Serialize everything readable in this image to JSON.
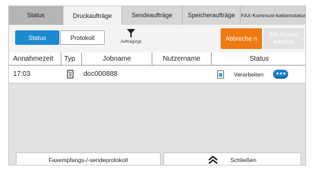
{
  "tabs": [
    {
      "label": "Status"
    },
    {
      "label": "Druckaufträge"
    },
    {
      "label": "Sendeaufträge"
    },
    {
      "label": "Speicheraufträge"
    },
    {
      "label": "FAX-Kommuni-kationsstatus"
    }
  ],
  "toolbar": {
    "status_label": "Status",
    "protokoll_label": "Protokoll",
    "filter_label": "Auftragstyp",
    "cancel_label": "Abbreche n",
    "hold_label": "Alle Drucke anhalten"
  },
  "table": {
    "columns": [
      "Annahmezeit",
      "Typ",
      "Jobname",
      "Nutzername",
      "Status"
    ],
    "rows": [
      {
        "time": "17:03",
        "type_icon": "print-document-icon",
        "jobname": "doc000888",
        "user": "",
        "status": "Verarbeiten"
      }
    ]
  },
  "bottom": {
    "fax_label": "Faxempfangs-/-sendeprotokoll",
    "close_label": "Schließen"
  },
  "colors": {
    "accent_blue": "#1c8ad0",
    "accent_orange": "#f07a12"
  }
}
